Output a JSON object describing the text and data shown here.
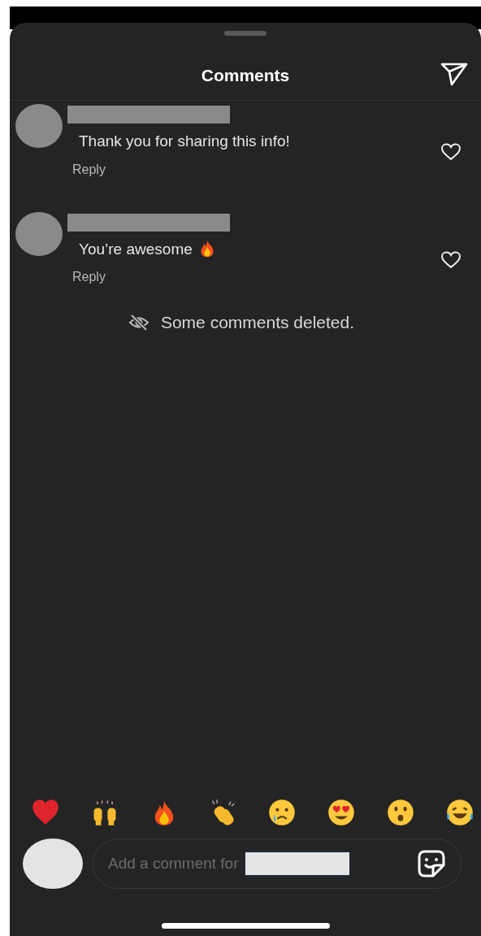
{
  "header": {
    "title": "Comments"
  },
  "comments": [
    {
      "text": "Thank you for sharing this info!",
      "fire_emoji": false,
      "liked": false,
      "reply": "Reply"
    },
    {
      "text": "You’re awesome",
      "fire_emoji": true,
      "liked": false,
      "reply": "Reply"
    }
  ],
  "notice": {
    "text": "Some comments deleted."
  },
  "composer": {
    "placeholder": "Add a comment for"
  }
}
